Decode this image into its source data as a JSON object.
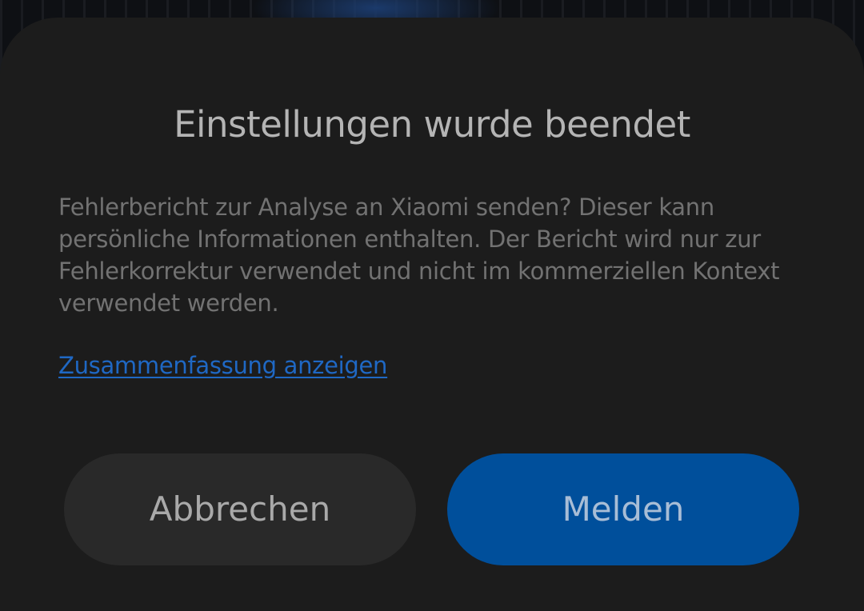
{
  "dialog": {
    "title": "Einstellungen wurde beendet",
    "message": "Fehlerbericht zur Analyse an Xiaomi senden? Dieser kann persönliche Informationen enthalten. Der Bericht wird nur zur Fehlerkorrektur verwendet und nicht im kommerziellen Kontext verwendet werden.",
    "summary_link": "Zusammenfassung anzeigen",
    "cancel_label": "Abbrechen",
    "report_label": "Melden"
  },
  "colors": {
    "dialog_background": "#1c1c1c",
    "link": "#1f68c4",
    "primary_button": "#004f9b",
    "secondary_button": "#292929"
  }
}
